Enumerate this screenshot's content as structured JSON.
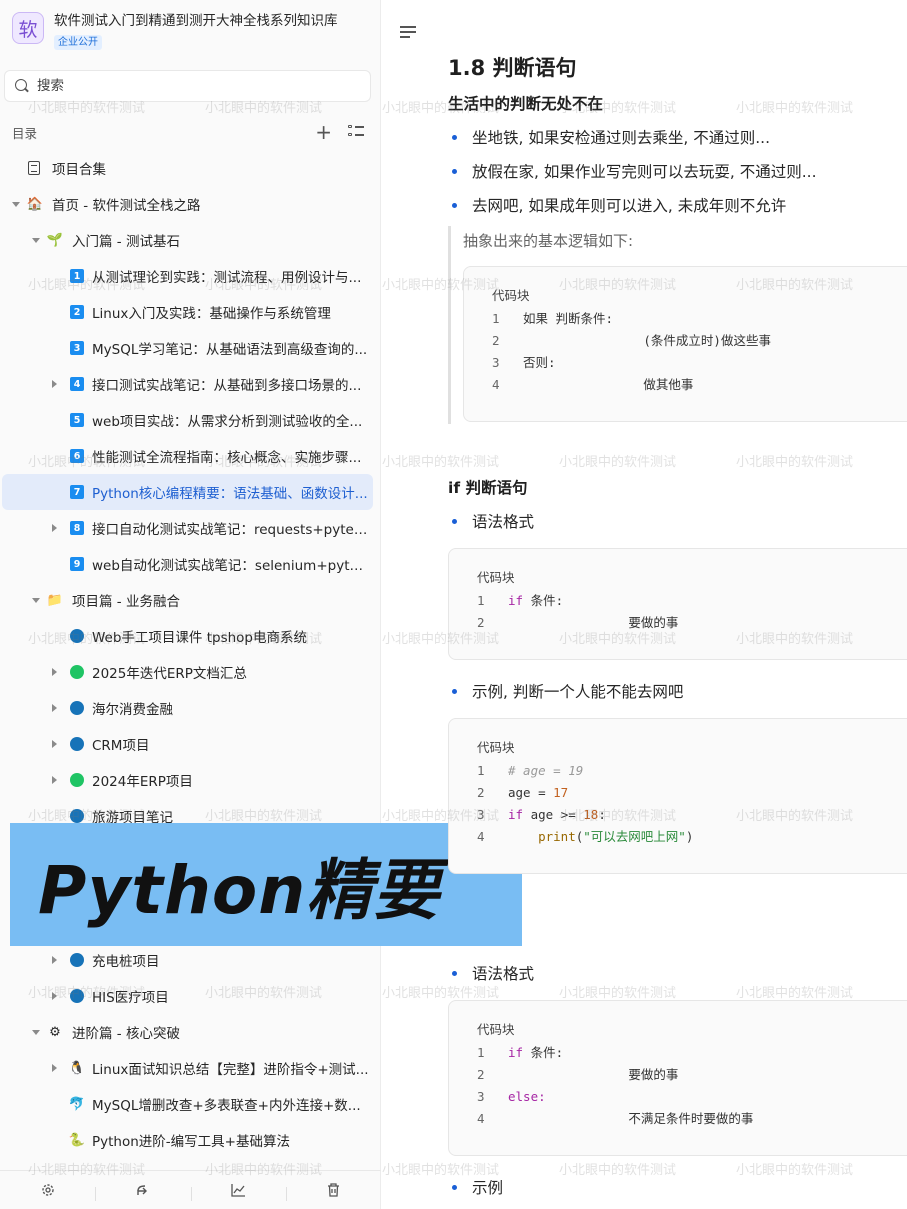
{
  "knowledge_base": {
    "avatar": "软",
    "title": "软件测试入门到精通到测开大神全栈系列知识库",
    "badge": "企业公开"
  },
  "search": {
    "placeholder": "搜索"
  },
  "toc": {
    "label": "目录"
  },
  "tree": [
    {
      "label": "项目合集",
      "icon": "doc",
      "caret": "",
      "level": 0
    },
    {
      "label": "首页 - 软件测试全栈之路",
      "icon": "🏠",
      "caret": "down",
      "level": 0
    },
    {
      "label": "入门篇 - 测试基石",
      "icon": "🌱",
      "caret": "down",
      "level": 1
    },
    {
      "label": "从测试理论到实践：测试流程、用例设计与...",
      "icon": "1",
      "caret": "",
      "level": 2
    },
    {
      "label": "Linux入门及实践：基础操作与系统管理",
      "icon": "2",
      "caret": "",
      "level": 2
    },
    {
      "label": "MySQL学习笔记：从基础语法到高级查询的...",
      "icon": "3",
      "caret": "",
      "level": 2
    },
    {
      "label": "接口测试实战笔记：从基础到多接口场景的...",
      "icon": "4",
      "caret": "right",
      "level": 2
    },
    {
      "label": "web项目实战：从需求分析到测试验收的全...",
      "icon": "5",
      "caret": "",
      "level": 2
    },
    {
      "label": "性能测试全流程指南：核心概念、实施步骤...",
      "icon": "6",
      "caret": "",
      "level": 2
    },
    {
      "label": "Python核心编程精要：语法基础、函数设计...",
      "icon": "7",
      "caret": "",
      "level": 2,
      "active": true
    },
    {
      "label": "接口自动化测试实战笔记：requests+pytes...",
      "icon": "8",
      "caret": "right",
      "level": 2
    },
    {
      "label": "web自动化测试实战笔记：selenium+pytes...",
      "icon": "9",
      "caret": "",
      "level": 2
    },
    {
      "label": "项目篇 - 业务融合",
      "icon": "📁",
      "caret": "down",
      "level": 1
    },
    {
      "label": "Web手工项目课件 tpshop电商系统",
      "icon": "blue",
      "caret": "",
      "level": 2
    },
    {
      "label": "2025年迭代ERP文档汇总",
      "icon": "green",
      "caret": "right",
      "level": 2
    },
    {
      "label": "海尔消费金融",
      "icon": "blue",
      "caret": "right",
      "level": 2
    },
    {
      "label": "CRM项目",
      "icon": "blue",
      "caret": "right",
      "level": 2
    },
    {
      "label": "2024年ERP项目",
      "icon": "green",
      "caret": "right",
      "level": 2
    },
    {
      "label": "旅游项目笔记",
      "icon": "blue",
      "caret": "",
      "level": 2
    },
    {
      "label": "",
      "icon": "",
      "caret": "",
      "level": 2
    },
    {
      "label": "",
      "icon": "",
      "caret": "",
      "level": 2
    },
    {
      "label": "",
      "icon": "",
      "caret": "",
      "level": 2
    },
    {
      "label": "充电桩项目",
      "icon": "blue",
      "caret": "right",
      "level": 2
    },
    {
      "label": "HIS医疗项目",
      "icon": "blue",
      "caret": "right",
      "level": 2
    },
    {
      "label": "进阶篇 - 核心突破",
      "icon": "⚙",
      "caret": "down",
      "level": 1
    },
    {
      "label": "Linux面试知识总结【完整】进阶指令+测试...",
      "icon": "🐧",
      "caret": "right",
      "level": 2
    },
    {
      "label": "MySQL增删改查+多表联查+内外连接+数...",
      "icon": "🐬",
      "caret": "",
      "level": 2
    },
    {
      "label": "Python进阶-编写工具+基础算法",
      "icon": "🐍",
      "caret": "",
      "level": 2
    }
  ],
  "bottom_bar": [
    "settings-icon",
    "share-icon",
    "stats-icon",
    "trash-icon"
  ],
  "banner": {
    "text": "Python精要"
  },
  "content": {
    "heading": "1.8 判断语句",
    "sub1": "生活中的判断无处不在",
    "bullets1": [
      "坐地铁, 如果安检通过则去乘坐, 不通过则...",
      "放假在家, 如果作业写完则可以去玩耍, 不通过则...",
      "去网吧, 如果成年则可以进入, 未成年则不允许"
    ],
    "quote": "抽象出来的基本逻辑如下:",
    "code_title": "代码块",
    "code1": [
      "如果 判断条件:",
      "                (条件成立时)做这些事",
      "否则:",
      "                做其他事"
    ],
    "sub2": "if 判断语句",
    "b_syntax": "语法格式",
    "code2": [
      "if 条件:",
      "                要做的事"
    ],
    "b_example": "示例, 判断一个人能不能去网吧",
    "code3": [
      "# age = 19",
      "age = 17",
      "if age >= 18:",
      "    print(\"可以去网吧上网\")"
    ],
    "b_syntax2": "语法格式",
    "code4": [
      "if 条件:",
      "                要做的事",
      "else:",
      "                不满足条件时要做的事"
    ],
    "b_example2": "示例",
    "line_numbers": [
      "1",
      "2",
      "3",
      "4"
    ]
  },
  "watermark": "小北眼中的软件测试",
  "colors": {
    "accent": "#1a5fd6",
    "active_bg": "#e3ebfa",
    "banner_bg": "#79bdf3"
  }
}
